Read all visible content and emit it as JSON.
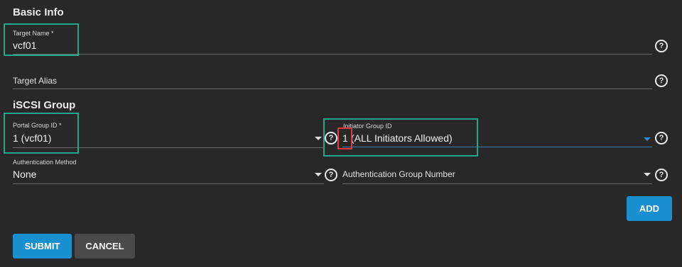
{
  "basic_info": {
    "title": "Basic Info",
    "target_name": {
      "label": "Target Name *",
      "value": "vcf01"
    },
    "target_alias": {
      "placeholder": "Target Alias"
    }
  },
  "iscsi_group": {
    "title": "iSCSI Group",
    "portal_group_id": {
      "label": "Portal Group ID *",
      "value": "1 (vcf01)"
    },
    "initiator_group_id": {
      "label": "Initiator Group ID",
      "value_number": "1",
      "value_rest": "(ALL Initiators Allowed)"
    },
    "authentication_method": {
      "label": "Authentication Method",
      "value": "None"
    },
    "authentication_group_number": {
      "placeholder": "Authentication Group Number"
    }
  },
  "buttons": {
    "add": "ADD",
    "submit": "SUBMIT",
    "cancel": "CANCEL"
  },
  "help_glyph": "?",
  "icons": [
    "help-circle-icon",
    "dropdown-caret-icon"
  ],
  "colors": {
    "background": "#282828",
    "primary_button": "#1a8fd0",
    "highlight_green": "#1fa98a",
    "highlight_red": "#e03a3a",
    "active_underline": "#2f7fb0"
  }
}
